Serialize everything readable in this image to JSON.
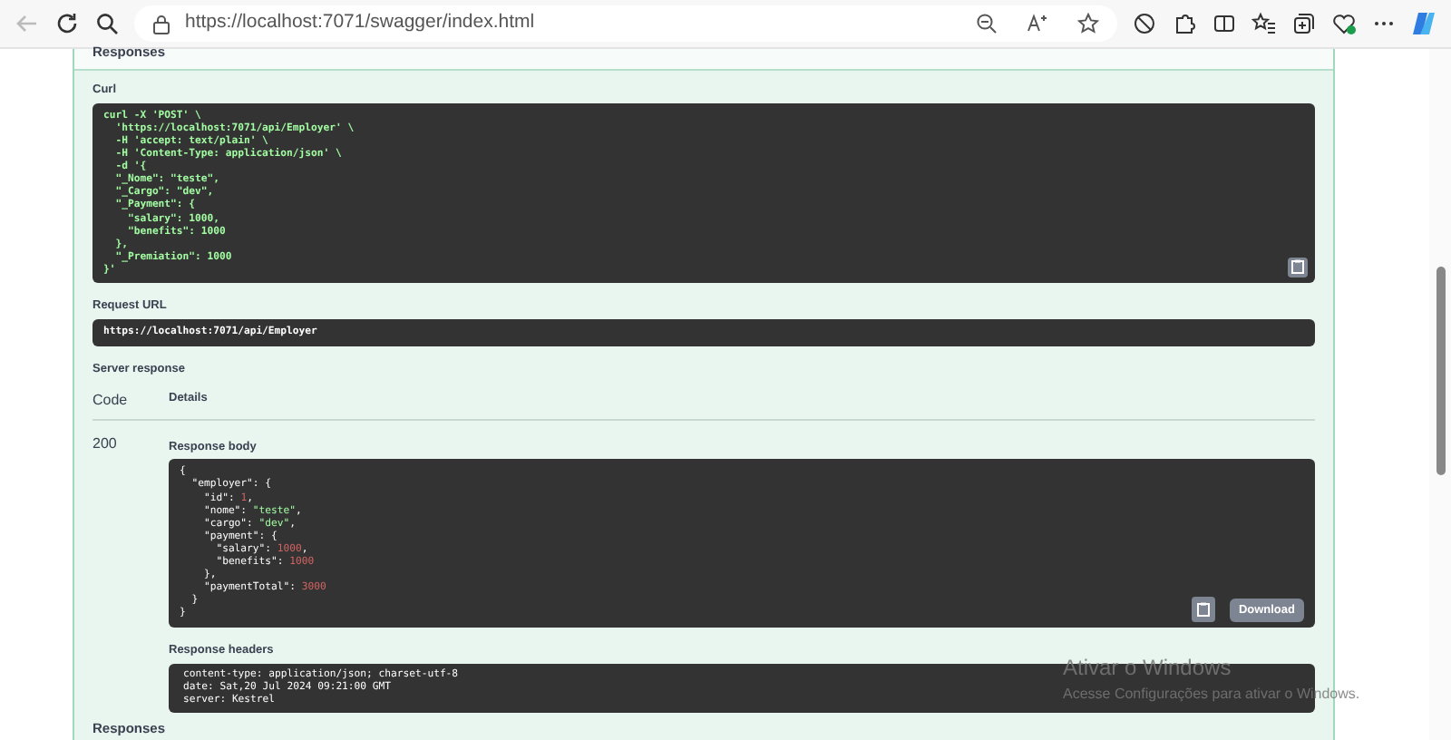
{
  "browser": {
    "back_disabled": true,
    "url": "https://localhost:7071/swagger/index.html"
  },
  "page": {
    "section_title": "Responses",
    "curl": {
      "label": "Curl",
      "lines": [
        "curl -X 'POST' \\",
        "  'https://localhost:7071/api/Employer' \\",
        "  -H 'accept: text/plain' \\",
        "  -H 'Content-Type: application/json' \\",
        "  -d '{",
        "  \"_Nome\": \"teste\",",
        "  \"_Cargo\": \"dev\",",
        "  \"_Payment\": {",
        "    \"salary\": 1000,",
        "    \"benefits\": 1000",
        "  },",
        "  \"_Premiation\": 1000",
        "}'"
      ]
    },
    "request_url": {
      "label": "Request URL",
      "value": "https://localhost:7071/api/Employer"
    },
    "server_response": {
      "label": "Server response",
      "columns": [
        "Code",
        "Details"
      ],
      "code": "200",
      "response_body": {
        "label": "Response body",
        "download": "Download",
        "lines": [
          [
            {
              "kind": "plain",
              "text": "{"
            }
          ],
          [
            {
              "kind": "plain",
              "text": "  \"employer\": {"
            }
          ],
          [
            {
              "kind": "plain",
              "text": "    \"id\": "
            },
            {
              "kind": "number",
              "text": "1"
            },
            {
              "kind": "plain",
              "text": ","
            }
          ],
          [
            {
              "kind": "plain",
              "text": "    \"nome\": "
            },
            {
              "kind": "string",
              "text": "\"teste\""
            },
            {
              "kind": "plain",
              "text": ","
            }
          ],
          [
            {
              "kind": "plain",
              "text": "    \"cargo\": "
            },
            {
              "kind": "string",
              "text": "\"dev\""
            },
            {
              "kind": "plain",
              "text": ","
            }
          ],
          [
            {
              "kind": "plain",
              "text": "    \"payment\": {"
            }
          ],
          [
            {
              "kind": "plain",
              "text": "      \"salary\": "
            },
            {
              "kind": "number",
              "text": "1000"
            },
            {
              "kind": "plain",
              "text": ","
            }
          ],
          [
            {
              "kind": "plain",
              "text": "      \"benefits\": "
            },
            {
              "kind": "number",
              "text": "1000"
            }
          ],
          [
            {
              "kind": "plain",
              "text": "    },"
            }
          ],
          [
            {
              "kind": "plain",
              "text": "    \"paymentTotal\": "
            },
            {
              "kind": "number",
              "text": "3000"
            }
          ],
          [
            {
              "kind": "plain",
              "text": "  }"
            }
          ],
          [
            {
              "kind": "plain",
              "text": "}"
            }
          ]
        ]
      },
      "response_headers": {
        "label": "Response headers",
        "lines": [
          "content-type: application/json; charset-utf-8",
          "date: Sat,20 Jul 2024 09:21:00 GMT",
          "server: Kestrel"
        ]
      }
    },
    "footer_title": "Responses"
  },
  "os_notice": {
    "title": "Ativar o Windows",
    "subtitle": "Acesse Configurações para ativar o Windows."
  }
}
